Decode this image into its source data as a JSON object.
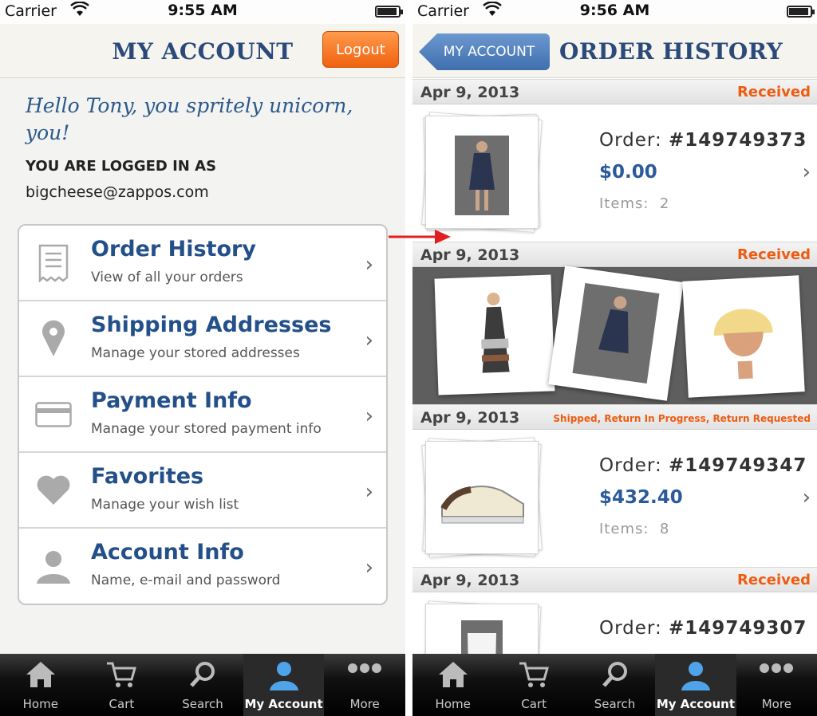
{
  "status_bars": {
    "left": {
      "carrier": "Carrier",
      "time": "9:55 AM"
    },
    "right": {
      "carrier": "Carrier",
      "time": "9:56 AM"
    }
  },
  "account": {
    "title": "MY ACCOUNT",
    "logout_label": "Logout",
    "greeting": "Hello Tony, you spritely unicorn, you!",
    "logged_in_label": "YOU ARE LOGGED IN AS",
    "email": "bigcheese@zappos.com",
    "menu": [
      {
        "icon": "receipt-icon",
        "title": "Order History",
        "subtitle": "View of all your orders"
      },
      {
        "icon": "location-pin-icon",
        "title": "Shipping Addresses",
        "subtitle": "Manage your stored addresses"
      },
      {
        "icon": "credit-card-icon",
        "title": "Payment Info",
        "subtitle": "Manage your stored payment info"
      },
      {
        "icon": "heart-icon",
        "title": "Favorites",
        "subtitle": "Manage your wish list"
      },
      {
        "icon": "person-icon",
        "title": "Account Info",
        "subtitle": "Name, e-mail and password"
      }
    ]
  },
  "order_history": {
    "title": "ORDER HISTORY",
    "back_label": "MY ACCOUNT",
    "orders": [
      {
        "date": "Apr 9, 2013",
        "status": "Received",
        "order_label": "Order:",
        "number": "#149749373",
        "price": "$0.00",
        "items_label": "Items:",
        "items": "2"
      },
      {
        "date": "Apr 9, 2013",
        "status": "Received"
      },
      {
        "date": "Apr 9, 2013",
        "status": "Shipped, Return In Progress, Return Requested",
        "order_label": "Order:",
        "number": "#149749347",
        "price": "$432.40",
        "items_label": "Items:",
        "items": "8"
      },
      {
        "date": "Apr 9, 2013",
        "status": "Received",
        "order_label": "Order:",
        "number": "#149749307"
      }
    ]
  },
  "tabbar": {
    "tabs": [
      {
        "label": "Home",
        "icon": "home-icon"
      },
      {
        "label": "Cart",
        "icon": "cart-icon"
      },
      {
        "label": "Search",
        "icon": "search-icon"
      },
      {
        "label": "My Account",
        "icon": "person-icon"
      },
      {
        "label": "More",
        "icon": "more-dots-icon"
      }
    ],
    "active": "My Account"
  },
  "colors": {
    "brand_blue": "#2b4a7a",
    "link_blue": "#24508a",
    "status_orange": "#ee5c12",
    "logout_orange": "#f0620f",
    "arrow_red": "#e02020"
  }
}
